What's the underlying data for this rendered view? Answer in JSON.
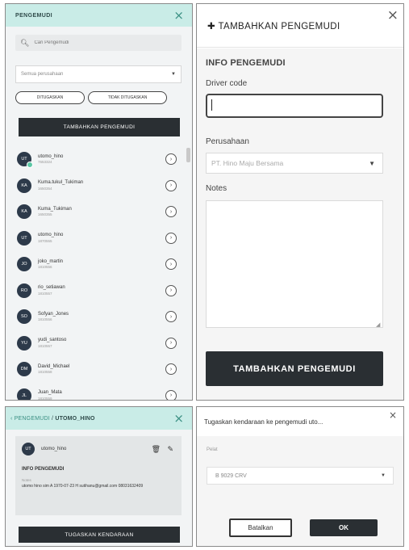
{
  "driver_list_panel": {
    "title": "PENGEMUDI",
    "search_placeholder": "Cari Pengemudi",
    "company_filter": "Semua perusahaan",
    "chips": [
      "DITUGASKAN",
      "TIDAK DITUGASKAN"
    ],
    "add_button": "TAMBAHKAN PENGEMUDI",
    "drivers": [
      {
        "initials": "UT",
        "name": "utomo_hino",
        "code": "7653324"
      },
      {
        "initials": "KA",
        "name": "Kuma.tukul_Tukiman",
        "code": "1650354"
      },
      {
        "initials": "KA",
        "name": "Kuma_Tukiman",
        "code": "1650355"
      },
      {
        "initials": "UT",
        "name": "utomo_hino",
        "code": "1870555"
      },
      {
        "initials": "JO",
        "name": "joko_martin",
        "code": "1810556"
      },
      {
        "initials": "RO",
        "name": "rio_setiawan",
        "code": "1810557"
      },
      {
        "initials": "SO",
        "name": "Sofyan_Jones",
        "code": "1810556"
      },
      {
        "initials": "YU",
        "name": "yudi_santoso",
        "code": "1810557"
      },
      {
        "initials": "DM",
        "name": "David_Michael",
        "code": "1810558"
      },
      {
        "initials": "JL",
        "name": "Juan_Mata",
        "code": "1810559"
      }
    ]
  },
  "add_driver_panel": {
    "title": "TAMBAHKAN PENGEMUDI",
    "section": "INFO PENGEMUDI",
    "driver_code_label": "Driver code",
    "driver_code_value": "",
    "company_label": "Perusahaan",
    "company_value": "PT. Hino Maju Bersama",
    "notes_label": "Notes",
    "submit": "TAMBAHKAN PENGEMUDI"
  },
  "driver_detail_panel": {
    "crumb_parent": "PENGEMUDI",
    "crumb_separator": "/",
    "crumb_current": "UTOMO_HINO",
    "initials": "UT",
    "name": "utomo_hino",
    "section": "INFO PENGEMUDI",
    "notes_label": "Notes",
    "notes_text": "utomo hino sim A 1970-07-23 H sutihanu@gmail.com 08031632409",
    "assign_button": "TUGASKAN KENDARAAN"
  },
  "assign_dialog": {
    "title": "Tugaskan kendaraan ke pengemudi uto...",
    "plate_label": "Pelat",
    "plate_value": "B 9029 CRV",
    "cancel": "Batalkan",
    "ok": "OK"
  },
  "colors": {
    "header_teal": "#c9ece7",
    "accent_teal": "#3a8f83",
    "dark_button": "#2a2f33",
    "online": "#5cc7a5",
    "avatar": "#2d3a4a"
  }
}
